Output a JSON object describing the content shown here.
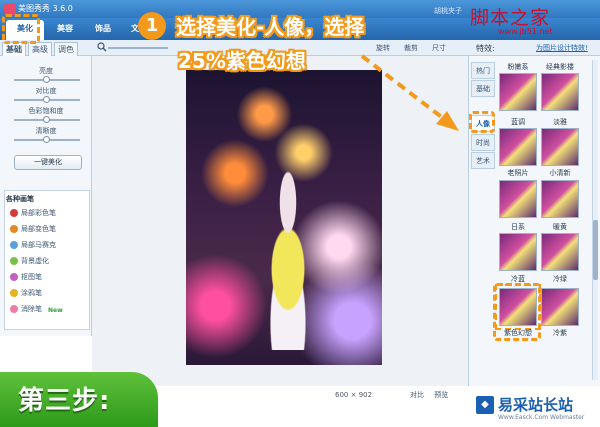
{
  "window": {
    "title": "美图秀秀 3.6.0",
    "user": "胡桃夹子"
  },
  "menu": {
    "tabs": [
      {
        "label": "美化",
        "active": true
      },
      {
        "label": "美容",
        "active": false
      },
      {
        "label": "饰品",
        "active": false
      },
      {
        "label": "文字",
        "active": false
      }
    ]
  },
  "brand": {
    "name": "脚本之家",
    "url": "www.jb51.net"
  },
  "subtabs": [
    {
      "label": "基础",
      "active": true
    },
    {
      "label": "高级"
    },
    {
      "label": "调色"
    }
  ],
  "toolbar": {
    "rotate": "旋转",
    "crop": "裁剪",
    "resize": "尺寸"
  },
  "adjustments": [
    {
      "label": "亮度"
    },
    {
      "label": "对比度"
    },
    {
      "label": "色彩饱和度"
    },
    {
      "label": "清晰度"
    }
  ],
  "one_key_button": "一键美化",
  "brushes": {
    "title": "各种画笔",
    "items": [
      "局部彩色笔",
      "局部变色笔",
      "局部马赛克",
      "背景虚化",
      "抠图笔",
      "涂鸦笔",
      "消除笔"
    ],
    "new_badge": "New"
  },
  "effects": {
    "header": "特效:",
    "link": "为图片设计特效!",
    "categories": [
      {
        "label": "热门",
        "active": false
      },
      {
        "label": "基础",
        "active": false
      },
      {
        "label": "人像",
        "active": true
      },
      {
        "label": "时尚",
        "active": false
      },
      {
        "label": "艺术",
        "active": false
      }
    ],
    "items": [
      "粉嫩系",
      "经典影楼",
      "蓝调",
      "淡雅",
      "老照片",
      "小清新",
      "日系",
      "暖黄",
      "冷蓝",
      "冷绿",
      "紫色幻想",
      "冷紫"
    ],
    "selected": "紫色幻想"
  },
  "status": {
    "width": "600",
    "x": "×",
    "height": "902",
    "compare": "对比",
    "preview": "预览"
  },
  "annotation": {
    "number": "1",
    "line1": "选择美化-人像，选择",
    "line2": "25%紫色幻想"
  },
  "step_banner": "第三步:",
  "watermark": {
    "name": "易采站长站",
    "url": "Www.Easck.Com Webmaster"
  },
  "colors": {
    "accent": "#f39a1c",
    "chrome": "#2e74be",
    "step_green": "#3fae26",
    "brand_red": "#c8102e"
  }
}
